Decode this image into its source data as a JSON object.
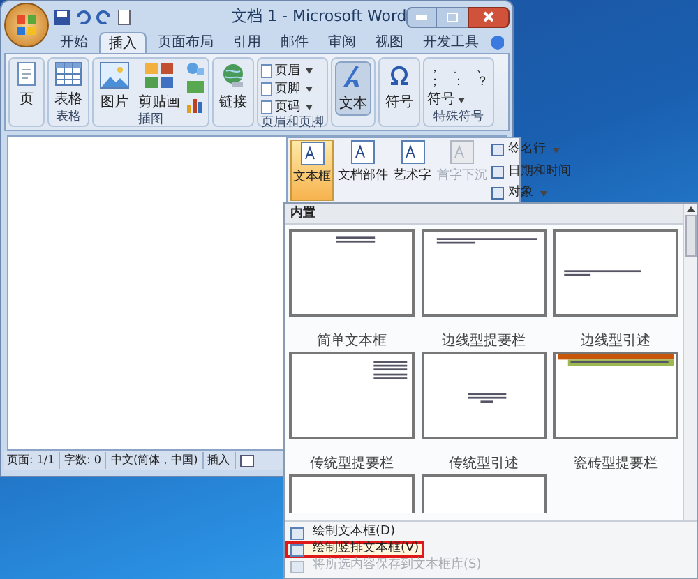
{
  "window": {
    "title": "文档 1 - Microsoft Word"
  },
  "tabs": [
    {
      "label": "开始",
      "selected": false
    },
    {
      "label": "插入",
      "selected": true
    },
    {
      "label": "页面布局",
      "selected": false
    },
    {
      "label": "引用",
      "selected": false
    },
    {
      "label": "邮件",
      "selected": false
    },
    {
      "label": "审阅",
      "selected": false
    },
    {
      "label": "视图",
      "selected": false
    },
    {
      "label": "开发工具",
      "selected": false
    }
  ],
  "ribbon_groups": [
    {
      "kind": "large",
      "buttons": [
        {
          "label": "页",
          "kind": "page",
          "pressed": false
        }
      ]
    },
    {
      "kind": "large",
      "label": "表格",
      "buttons": [
        {
          "label": "表格",
          "kind": "table",
          "pressed": false
        }
      ]
    },
    {
      "kind": "illustrations",
      "label": "插图",
      "buttons": [
        {
          "label": "图片",
          "kind": "picture",
          "pressed": false
        },
        {
          "label": "剪贴画",
          "kind": "clipart",
          "pressed": false
        }
      ]
    },
    {
      "kind": "large",
      "buttons": [
        {
          "label": "链接",
          "kind": "link",
          "pressed": false
        }
      ]
    },
    {
      "kind": "small",
      "label": "页眉和页脚",
      "buttons": [
        {
          "label": "页眉"
        },
        {
          "label": "页脚"
        },
        {
          "label": "页码"
        }
      ]
    },
    {
      "kind": "large",
      "buttons": [
        {
          "label": "文本",
          "kind": "text",
          "pressed": true
        }
      ]
    },
    {
      "kind": "large",
      "buttons": [
        {
          "label": "符号",
          "kind": "omega",
          "pressed": false
        }
      ]
    },
    {
      "kind": "punct",
      "label": "特殊符号",
      "chars": [
        "，",
        "。",
        "、",
        "；",
        "：",
        "？"
      ],
      "button": "符号"
    }
  ],
  "text_menu": {
    "large": [
      {
        "label": "文本框",
        "selected": true,
        "disabled": false
      },
      {
        "label": "文档部件",
        "selected": false,
        "disabled": false
      },
      {
        "label": "艺术字",
        "selected": false,
        "disabled": false
      },
      {
        "label": "首字下沉",
        "selected": false,
        "disabled": true
      }
    ],
    "small": [
      {
        "label": "签名行",
        "dropdown": true
      },
      {
        "label": "日期和时间",
        "dropdown": false
      },
      {
        "label": "对象",
        "dropdown": true
      }
    ]
  },
  "gallery": {
    "header": "内置",
    "items": [
      {
        "label": "简单文本框",
        "kind": "simple"
      },
      {
        "label": "边线型提要栏",
        "kind": "top"
      },
      {
        "label": "边线型引述",
        "kind": "quote"
      },
      {
        "label": "传统型提要栏",
        "kind": "side"
      },
      {
        "label": "传统型引述",
        "kind": "center"
      },
      {
        "label": "瓷砖型提要栏",
        "kind": "tile"
      },
      {
        "kind": "blank"
      },
      {
        "kind": "blank"
      }
    ],
    "commands": [
      {
        "label": "绘制文本框(D)",
        "disabled": false,
        "highlighted": false
      },
      {
        "label": "绘制竖排文本框(V)",
        "disabled": false,
        "highlighted": true
      },
      {
        "label": "将所选内容保存到文本框库(S)",
        "disabled": true,
        "highlighted": false
      }
    ]
  },
  "status_bar": [
    "页面: 1/1",
    "字数: 0",
    "中文(简体，中国)",
    "插入"
  ]
}
